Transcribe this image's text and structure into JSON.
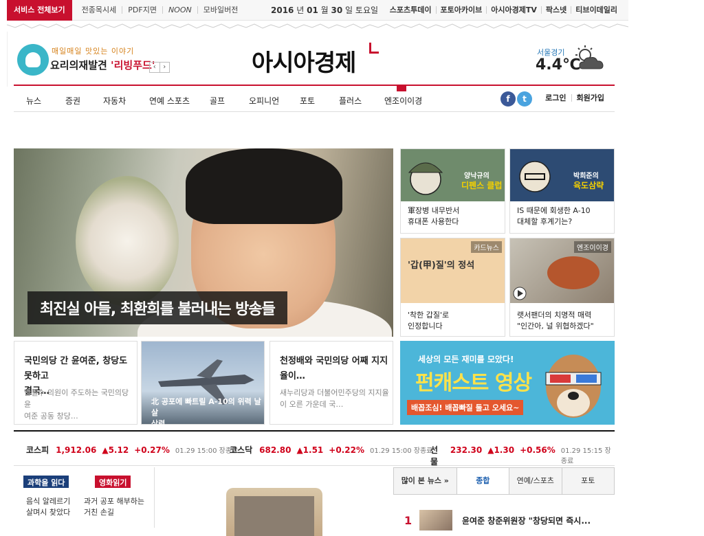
{
  "topbar": {
    "service_all": "서비스 전체보기",
    "links": [
      "전종목시세",
      "PDF지면",
      "NOON",
      "모바일버전"
    ],
    "date_year": "2016",
    "date_y_unit": "년",
    "date_month": "01",
    "date_m_unit": "월",
    "date_day": "30",
    "date_d_unit": "일",
    "date_weekday": "토요일",
    "right_links": [
      "스포츠투데이",
      "포토아카이브",
      "아시아경제TV",
      "팍스넷",
      "티브이데일리"
    ]
  },
  "header": {
    "promo_sub": "매일매일 맛있는 이야기",
    "promo_main_prefix": "요리의재발견 ",
    "promo_main_highlight": "'리빙푸드'",
    "promo_prev": "‹",
    "promo_next": "›",
    "logo": "아시아경제",
    "weather_loc": "서울경기",
    "weather_temp": "4.4℃"
  },
  "nav": {
    "items": [
      "뉴스",
      "증권",
      "자동차",
      "연예 스포츠",
      "골프",
      "오피니언",
      "포토",
      "플러스",
      "엔조이이경"
    ],
    "facebook": "f",
    "twitter": "t",
    "login": "로그인",
    "signup": "회원가입"
  },
  "hero": {
    "caption": "최진실 아들, 최환희를 불러내는 방송들"
  },
  "cards": [
    {
      "title_a": "양낙규의",
      "title_b": "디펜스 클럽",
      "text": [
        "軍장병 내무반서",
        "휴대폰 사용한다"
      ]
    },
    {
      "title_a": "박희준의",
      "title_b": "육도삼략",
      "text": [
        "IS 때문에 회생한 A-10",
        "대체할 후계기는?"
      ]
    },
    {
      "tag": "카드뉴스",
      "image_text": "'갑(甲)질'의 정석",
      "text": [
        "'착한 갑질'로",
        "인정합니다"
      ]
    },
    {
      "tag": "엔조이이경",
      "text": [
        "랫서팬더의 치명적 매력",
        "\"인간아, 널 위협하겠다\""
      ]
    }
  ],
  "news": [
    {
      "title": [
        "국민의당 간 윤여준, 창당도 못하고",
        "결국…"
      ],
      "summary": [
        "안철수 의원이 주도하는 국민의당 윤",
        "여준 공동 창당…"
      ]
    },
    {
      "caption": [
        "北 공포에 빠트릴 A-10의 위력 날 살",
        "상력"
      ]
    },
    {
      "title": [
        "천정배와 국민의당 어째 지지",
        "율이…"
      ],
      "summary": [
        "새누리당과 더불어민주당의 지지율",
        "이 오른 가운데 국…"
      ]
    }
  ],
  "banner": {
    "line1": "세상의 모든 재미를 모았다!",
    "line2": "펀캐스트 영상",
    "line3": "배꼽조심! 배꼽빠질 둘고 오세요~"
  },
  "ticker": [
    {
      "name": "코스피",
      "value": "1,912.06",
      "change": "▲5.12",
      "pct": "+0.27%",
      "time": "01.29 15:00 장종료"
    },
    {
      "name": "코스닥",
      "value": "682.80",
      "change": "▲1.51",
      "pct": "+0.22%",
      "time": "01.29 15:00 장종료"
    },
    {
      "name": "선물",
      "value": "232.30",
      "change": "▲1.30",
      "pct": "+0.56%",
      "time": "01.29 15:15 장종료"
    }
  ],
  "bottom": {
    "label1": "과학을 읽다",
    "label1_text": [
      "음식 알레르기",
      "살며시 찾았다"
    ],
    "label2": "영화읽기",
    "label2_text": [
      "과거 공포 해부하는",
      "거친 손길"
    ]
  },
  "popular": {
    "head": "많이 본 뉴스 »",
    "tabs": [
      "종합",
      "연예/스포츠",
      "포토"
    ],
    "rank": "1",
    "title": "윤여준 창준위원장 \"창당되면 즉시..."
  },
  "colors": {
    "brand_red": "#c8102e",
    "up_red": "#d0021b",
    "link_blue": "#1b5eae"
  }
}
